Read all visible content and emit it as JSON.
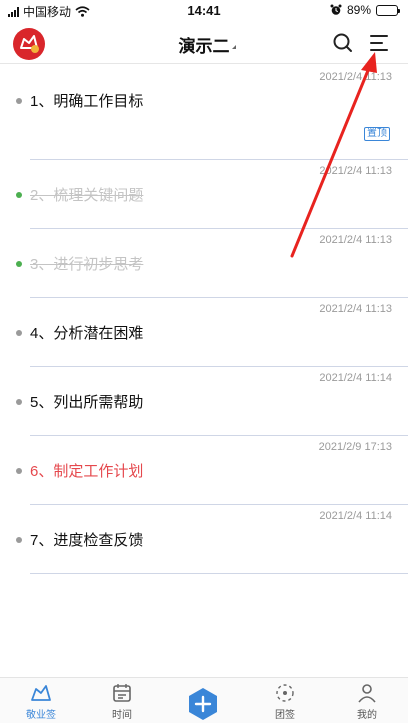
{
  "status_bar": {
    "carrier": "中国移动",
    "time": "14:41",
    "battery": "89%",
    "battery_level": 0.89
  },
  "header": {
    "title": "演示二"
  },
  "notes": [
    {
      "time": "2021/2/4 11:13",
      "text": "1、明确工作目标",
      "badge": "置顶"
    },
    {
      "time": "2021/2/4 11:13",
      "text": "2、梳理关键问题",
      "status": "done"
    },
    {
      "time": "2021/2/4 11:13",
      "text": "3、进行初步思考",
      "status": "done"
    },
    {
      "time": "2021/2/4 11:13",
      "text": "4、分析潜在困难"
    },
    {
      "time": "2021/2/4 11:14",
      "text": "5、列出所需帮助"
    },
    {
      "time": "2021/2/9 17:13",
      "text": "6、制定工作计划",
      "color": "#e5484d"
    },
    {
      "time": "2021/2/4 11:14",
      "text": "7、进度检查反馈"
    }
  ],
  "colors": {
    "accent": "#3a86d8",
    "dot_default": "#9a9a9a",
    "dot_done": "#4caf50",
    "highlight_red": "#e5484d",
    "annotation_arrow": "#e8231f"
  },
  "tabbar": {
    "items": [
      {
        "label": "敬业签",
        "icon": "notes-icon"
      },
      {
        "label": "时间",
        "icon": "calendar-icon"
      },
      {
        "label": "",
        "icon": "add-icon"
      },
      {
        "label": "团签",
        "icon": "team-icon"
      },
      {
        "label": "我的",
        "icon": "profile-icon"
      }
    ]
  }
}
